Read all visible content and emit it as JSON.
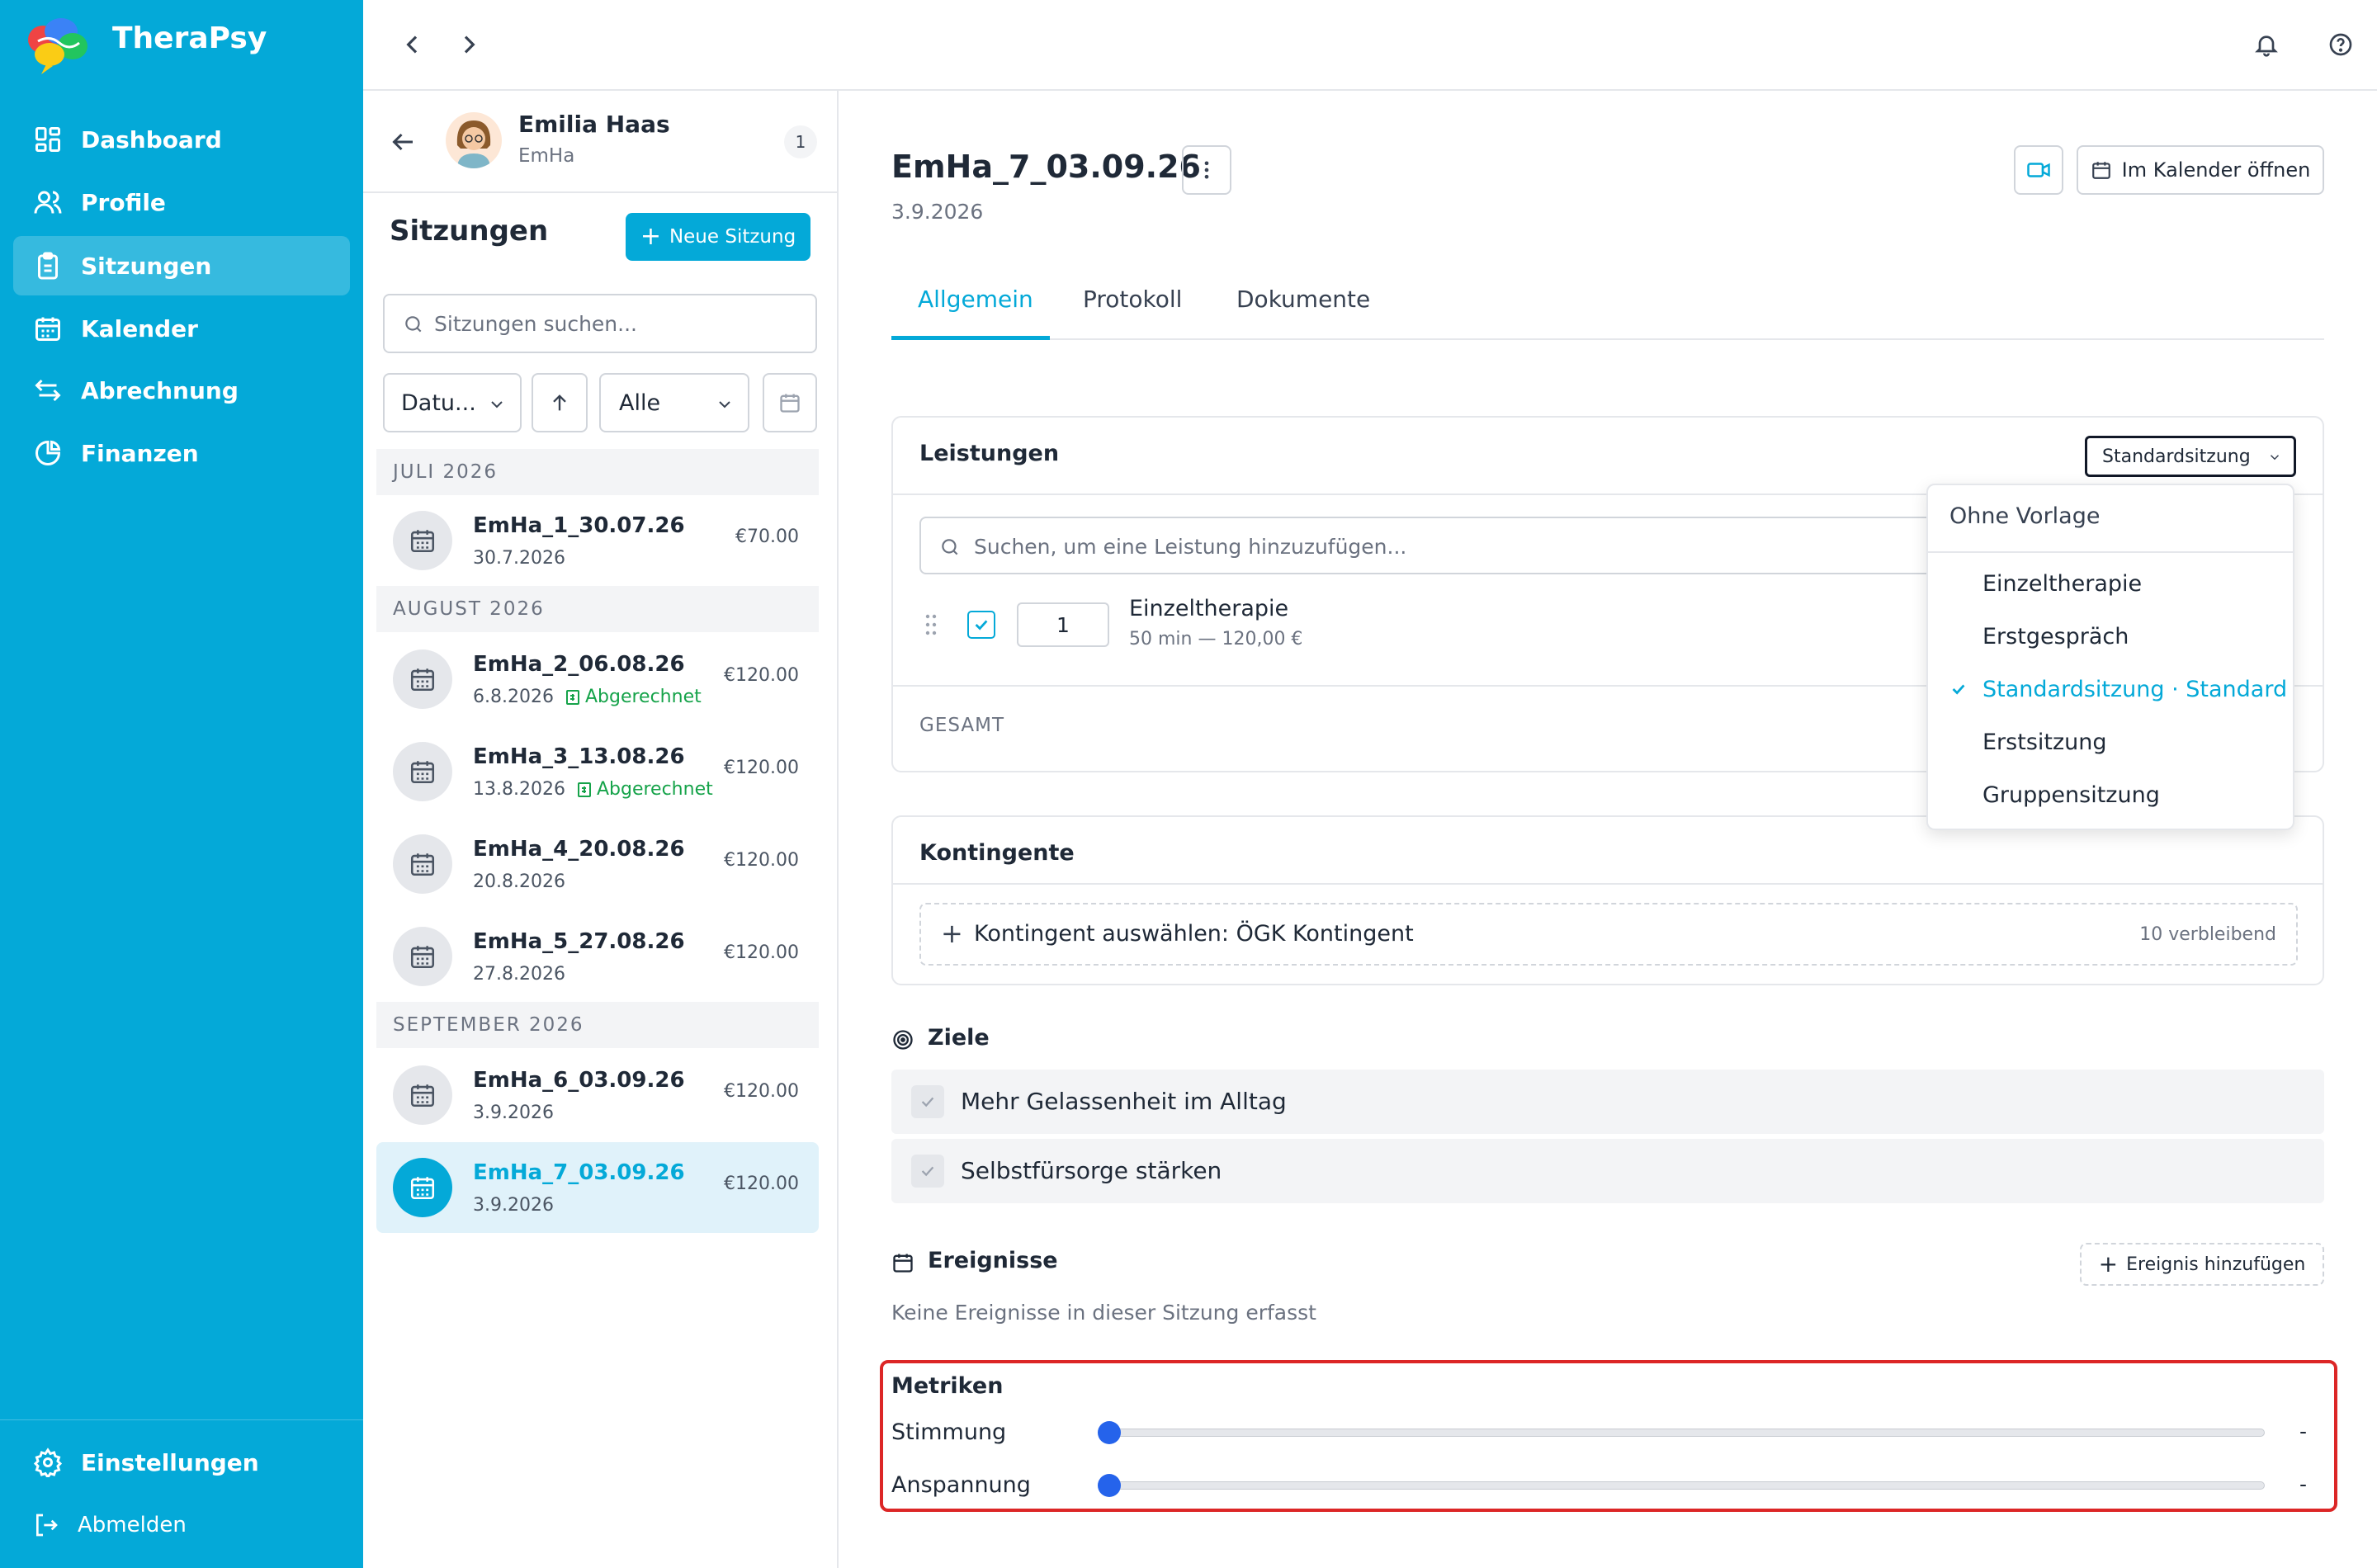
{
  "app": {
    "name": "TheraPsy"
  },
  "sidebar": {
    "items": [
      {
        "label": "Dashboard",
        "icon": "dashboard-icon"
      },
      {
        "label": "Profile",
        "icon": "users-icon"
      },
      {
        "label": "Sitzungen",
        "icon": "clipboard-icon",
        "active": true
      },
      {
        "label": "Kalender",
        "icon": "calendar-icon"
      },
      {
        "label": "Abrechnung",
        "icon": "arrows-exchange-icon"
      },
      {
        "label": "Finanzen",
        "icon": "pie-chart-icon"
      }
    ],
    "settings_label": "Einstellungen",
    "logout_label": "Abmelden"
  },
  "patient": {
    "name": "Emilia Haas",
    "code": "EmHa",
    "badge": "1"
  },
  "sessions_panel": {
    "title": "Sitzungen",
    "new_button": "Neue Sitzung",
    "search_placeholder": "Sitzungen suchen...",
    "sort_select": "Datu...",
    "filter_select": "Alle",
    "groups": [
      {
        "month": "JULI 2026",
        "sessions": [
          {
            "title": "EmHa_1_30.07.26",
            "date": "30.7.2026",
            "price": "€70.00",
            "billed": ""
          }
        ]
      },
      {
        "month": "AUGUST 2026",
        "sessions": [
          {
            "title": "EmHa_2_06.08.26",
            "date": "6.8.2026",
            "price": "€120.00",
            "billed": "Abgerechnet"
          },
          {
            "title": "EmHa_3_13.08.26",
            "date": "13.8.2026",
            "price": "€120.00",
            "billed": "Abgerechnet"
          },
          {
            "title": "EmHa_4_20.08.26",
            "date": "20.8.2026",
            "price": "€120.00",
            "billed": ""
          },
          {
            "title": "EmHa_5_27.08.26",
            "date": "27.8.2026",
            "price": "€120.00",
            "billed": ""
          }
        ]
      },
      {
        "month": "SEPTEMBER 2026",
        "sessions": [
          {
            "title": "EmHa_6_03.09.26",
            "date": "3.9.2026",
            "price": "€120.00",
            "billed": ""
          },
          {
            "title": "EmHa_7_03.09.26",
            "date": "3.9.2026",
            "price": "€120.00",
            "billed": "",
            "active": true
          }
        ]
      }
    ]
  },
  "detail": {
    "title": "EmHa_7_03.09.26",
    "date": "3.9.2026",
    "calendar_button": "Im Kalender öffnen",
    "tabs": [
      "Allgemein",
      "Protokoll",
      "Dokumente"
    ],
    "active_tab": "Allgemein",
    "services": {
      "title": "Leistungen",
      "template_select": "Standardsitzung",
      "search_placeholder": "Suchen, um eine Leistung hinzuzufügen...",
      "item": {
        "qty": "1",
        "name": "Einzeltherapie",
        "meta": "50 min — 120,00 €"
      },
      "total_label": "GESAMT"
    },
    "template_dropdown": {
      "header": "Ohne Vorlage",
      "options": [
        "Einzeltherapie",
        "Erstgespräch",
        "Standardsitzung · Standard",
        "Erstsitzung",
        "Gruppensitzung"
      ],
      "selected": "Standardsitzung · Standard"
    },
    "contingents": {
      "title": "Kontingente",
      "select_label": "Kontingent auswählen: ÖGK Kontingent",
      "remaining": "10 verbleibend"
    },
    "goals": {
      "title": "Ziele",
      "items": [
        "Mehr Gelassenheit im Alltag",
        "Selbstfürsorge stärken"
      ]
    },
    "events": {
      "title": "Ereignisse",
      "add_button": "Ereignis hinzufügen",
      "empty_text": "Keine Ereignisse in dieser Sitzung erfasst"
    },
    "metrics": {
      "title": "Metriken",
      "items": [
        {
          "label": "Stimmung",
          "value": 0,
          "display": "-"
        },
        {
          "label": "Anspannung",
          "value": 0,
          "display": "-"
        }
      ]
    }
  },
  "colors": {
    "accent": "#04a9d8",
    "success": "#16a34a",
    "highlight": "#dc2626",
    "slider": "#2563eb"
  }
}
